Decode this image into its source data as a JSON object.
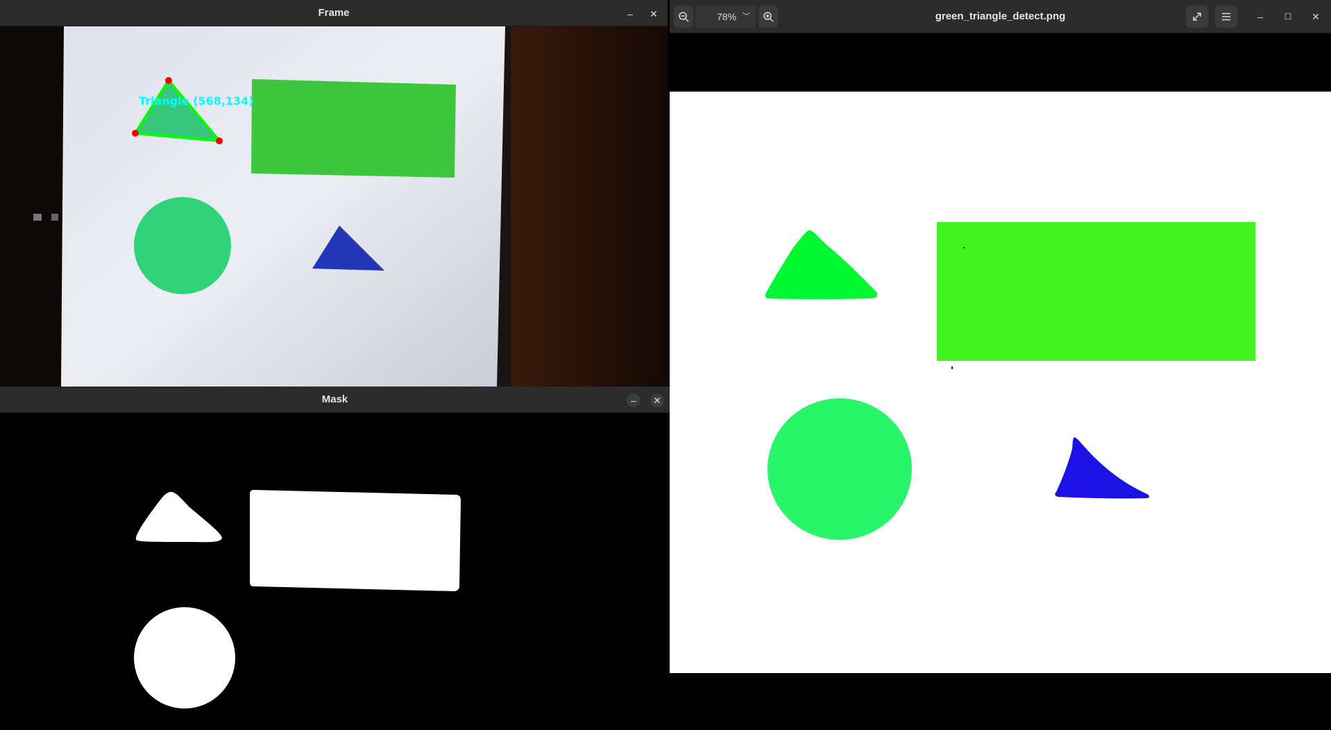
{
  "frame_window": {
    "title": "Frame",
    "minimize_glyph": "–",
    "close_glyph": "✕",
    "detection_label": "Triangle (568,134)"
  },
  "mask_window": {
    "title": "Mask",
    "minimize_glyph": "–",
    "close_glyph": "✕"
  },
  "viewer": {
    "title": "green_triangle_detect.png",
    "zoom": "78%",
    "zoom_out_icon": "zoom-out-icon",
    "zoom_in_icon": "zoom-in-icon",
    "fullscreen_icon": "fullscreen-icon",
    "menu_icon": "menu-icon",
    "minimize_glyph": "–",
    "maximize_glyph": "☐",
    "close_glyph": "✕"
  },
  "colors": {
    "titlebar": "#2b2b2b",
    "detection_outline": "#00ff00",
    "detection_points": "#ff0000",
    "label_cyan": "#00ffff",
    "shape_triangle_green": "#00f832",
    "shape_rectangle_green": "#41f21f",
    "shape_circle_green": "#28f56a",
    "shape_triangle_blue": "#1c12e6"
  }
}
